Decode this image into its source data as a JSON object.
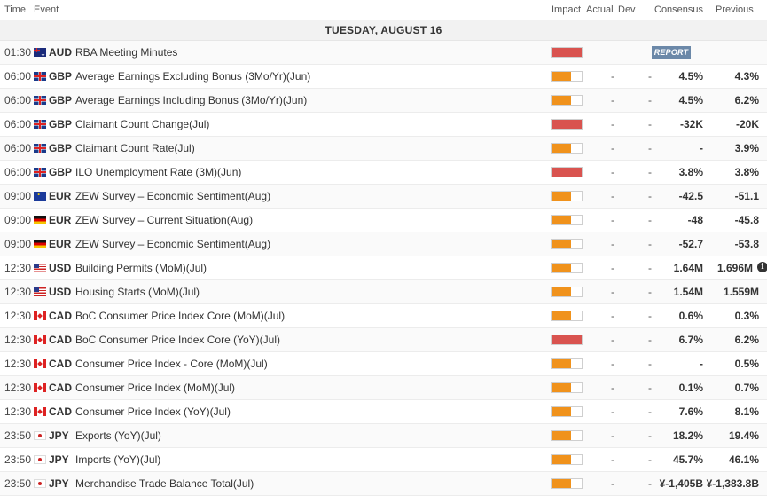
{
  "header": {
    "time": "Time",
    "event": "Event",
    "impact": "Impact",
    "actual": "Actual",
    "dev": "Dev",
    "consensus": "Consensus",
    "previous": "Previous"
  },
  "day_label": "TUESDAY, AUGUST 16",
  "colors": {
    "high": "#d9534f",
    "medium": "#f0921c"
  },
  "rows": [
    {
      "time": "01:30",
      "flag": "aud",
      "currency": "AUD",
      "event": "RBA Meeting Minutes",
      "impact": "high",
      "impact_fill": 1.0,
      "actual": "",
      "dev": "",
      "consensus": "",
      "previous": "",
      "report": "REPORT"
    },
    {
      "time": "06:00",
      "flag": "gbp",
      "currency": "GBP",
      "event": "Average Earnings Excluding Bonus (3Mo/Yr)(Jun)",
      "impact": "medium",
      "impact_fill": 0.66,
      "actual": "-",
      "dev": "-",
      "consensus": "4.5%",
      "previous": "4.3%"
    },
    {
      "time": "06:00",
      "flag": "gbp",
      "currency": "GBP",
      "event": "Average Earnings Including Bonus (3Mo/Yr)(Jun)",
      "impact": "medium",
      "impact_fill": 0.66,
      "actual": "-",
      "dev": "-",
      "consensus": "4.5%",
      "previous": "6.2%"
    },
    {
      "time": "06:00",
      "flag": "gbp",
      "currency": "GBP",
      "event": "Claimant Count Change(Jul)",
      "impact": "high",
      "impact_fill": 1.0,
      "actual": "-",
      "dev": "-",
      "consensus": "-32K",
      "previous": "-20K"
    },
    {
      "time": "06:00",
      "flag": "gbp",
      "currency": "GBP",
      "event": "Claimant Count Rate(Jul)",
      "impact": "medium",
      "impact_fill": 0.66,
      "actual": "-",
      "dev": "-",
      "consensus": "-",
      "previous": "3.9%"
    },
    {
      "time": "06:00",
      "flag": "gbp",
      "currency": "GBP",
      "event": "ILO Unemployment Rate (3M)(Jun)",
      "impact": "high",
      "impact_fill": 1.0,
      "actual": "-",
      "dev": "-",
      "consensus": "3.8%",
      "previous": "3.8%"
    },
    {
      "time": "09:00",
      "flag": "eu",
      "currency": "EUR",
      "event": "ZEW Survey – Economic Sentiment(Aug)",
      "impact": "medium",
      "impact_fill": 0.66,
      "actual": "-",
      "dev": "-",
      "consensus": "-42.5",
      "previous": "-51.1"
    },
    {
      "time": "09:00",
      "flag": "de",
      "currency": "EUR",
      "event": "ZEW Survey – Current Situation(Aug)",
      "impact": "medium",
      "impact_fill": 0.66,
      "actual": "-",
      "dev": "-",
      "consensus": "-48",
      "previous": "-45.8"
    },
    {
      "time": "09:00",
      "flag": "de",
      "currency": "EUR",
      "event": "ZEW Survey – Economic Sentiment(Aug)",
      "impact": "medium",
      "impact_fill": 0.66,
      "actual": "-",
      "dev": "-",
      "consensus": "-52.7",
      "previous": "-53.8"
    },
    {
      "time": "12:30",
      "flag": "us",
      "currency": "USD",
      "event": "Building Permits (MoM)(Jul)",
      "impact": "medium",
      "impact_fill": 0.66,
      "actual": "-",
      "dev": "-",
      "consensus": "1.64M",
      "previous": "1.696M",
      "info": true
    },
    {
      "time": "12:30",
      "flag": "us",
      "currency": "USD",
      "event": "Housing Starts (MoM)(Jul)",
      "impact": "medium",
      "impact_fill": 0.66,
      "actual": "-",
      "dev": "-",
      "consensus": "1.54M",
      "previous": "1.559M"
    },
    {
      "time": "12:30",
      "flag": "ca",
      "currency": "CAD",
      "event": "BoC Consumer Price Index Core (MoM)(Jul)",
      "impact": "medium",
      "impact_fill": 0.66,
      "actual": "-",
      "dev": "-",
      "consensus": "0.6%",
      "previous": "0.3%"
    },
    {
      "time": "12:30",
      "flag": "ca",
      "currency": "CAD",
      "event": "BoC Consumer Price Index Core (YoY)(Jul)",
      "impact": "high",
      "impact_fill": 1.0,
      "actual": "-",
      "dev": "-",
      "consensus": "6.7%",
      "previous": "6.2%"
    },
    {
      "time": "12:30",
      "flag": "ca",
      "currency": "CAD",
      "event": "Consumer Price Index - Core (MoM)(Jul)",
      "impact": "medium",
      "impact_fill": 0.66,
      "actual": "-",
      "dev": "-",
      "consensus": "-",
      "previous": "0.5%"
    },
    {
      "time": "12:30",
      "flag": "ca",
      "currency": "CAD",
      "event": "Consumer Price Index (MoM)(Jul)",
      "impact": "medium",
      "impact_fill": 0.66,
      "actual": "-",
      "dev": "-",
      "consensus": "0.1%",
      "previous": "0.7%"
    },
    {
      "time": "12:30",
      "flag": "ca",
      "currency": "CAD",
      "event": "Consumer Price Index (YoY)(Jul)",
      "impact": "medium",
      "impact_fill": 0.66,
      "actual": "-",
      "dev": "-",
      "consensus": "7.6%",
      "previous": "8.1%"
    },
    {
      "time": "23:50",
      "flag": "jp",
      "currency": "JPY",
      "event": "Exports (YoY)(Jul)",
      "impact": "medium",
      "impact_fill": 0.66,
      "actual": "-",
      "dev": "-",
      "consensus": "18.2%",
      "previous": "19.4%"
    },
    {
      "time": "23:50",
      "flag": "jp",
      "currency": "JPY",
      "event": "Imports (YoY)(Jul)",
      "impact": "medium",
      "impact_fill": 0.66,
      "actual": "-",
      "dev": "-",
      "consensus": "45.7%",
      "previous": "46.1%"
    },
    {
      "time": "23:50",
      "flag": "jp",
      "currency": "JPY",
      "event": "Merchandise Trade Balance Total(Jul)",
      "impact": "medium",
      "impact_fill": 0.66,
      "actual": "-",
      "dev": "-",
      "consensus": "¥-1,405B",
      "previous": "¥-1,383.8B"
    }
  ]
}
